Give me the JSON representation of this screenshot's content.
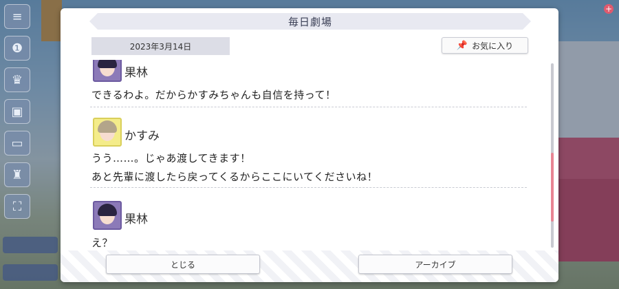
{
  "dialog": {
    "title": "毎日劇場",
    "date": "2023年3月14日",
    "favorite_label": "お気に入り",
    "close_label": "とじる",
    "archive_label": "アーカイブ"
  },
  "messages": [
    {
      "speaker": "果林",
      "avatar": "karin-avatar",
      "lines": [
        "できるわよ。だからかすみちゃんも自信を持って！"
      ]
    },
    {
      "speaker": "かすみ",
      "avatar": "kasumi-avatar",
      "lines": [
        "うう……。じゃあ渡してきます！",
        "あと先輩に渡したら戻ってくるからここにいてくださいね！"
      ]
    },
    {
      "speaker": "果林",
      "avatar": "karin-avatar",
      "lines": [
        "え？"
      ]
    }
  ],
  "icons": {
    "favorite": "pin-icon",
    "menu": "hamburger-menu-icon"
  },
  "colors": {
    "scroll_thumb": "#e88493",
    "title_bar": "#e8e9f1",
    "date_tag": "#dcdde6"
  }
}
